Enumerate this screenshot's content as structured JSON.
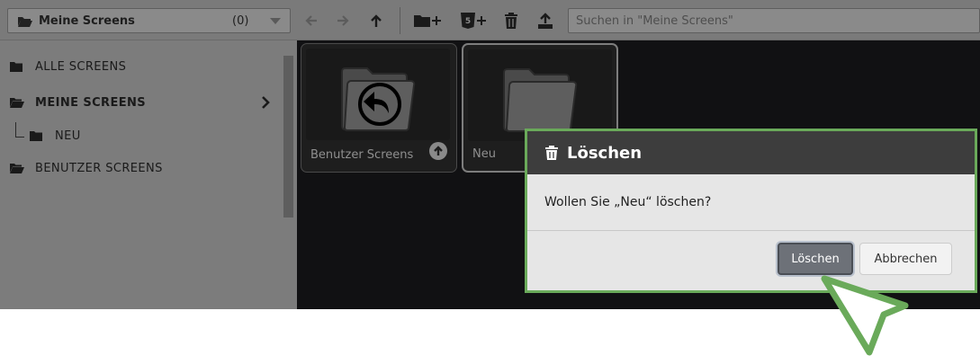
{
  "toolbar": {
    "folder_select": {
      "name": "Meine Screens",
      "count": "(0)"
    },
    "search_placeholder": "Suchen in \"Meine Screens\"",
    "buttons": [
      "back-icon",
      "forward-icon",
      "up-arrow-icon",
      "new-folder-icon",
      "new-html5-screen-icon",
      "trash-icon",
      "upload-icon"
    ]
  },
  "sidebar": {
    "items": [
      {
        "label": "ALLE SCREENS",
        "icon": "folder-icon"
      },
      {
        "label": "MEINE SCREENS",
        "icon": "folder-open-icon",
        "active": true
      },
      {
        "label": "NEU",
        "icon": "folder-icon"
      },
      {
        "label": "BENUTZER SCREENS",
        "icon": "folder-open-icon"
      }
    ]
  },
  "content": {
    "tiles": [
      {
        "label": "Benutzer Screens",
        "icon": "folder-back-icon"
      },
      {
        "label": "Neu",
        "icon": "folder-icon",
        "selected": true
      }
    ]
  },
  "dialog": {
    "title": "Löschen",
    "message": "Wollen Sie „Neu“ löschen?",
    "confirm_label": "Löschen",
    "cancel_label": "Abbrechen"
  },
  "colors": {
    "highlight": "#6aaa5a",
    "dialog_header": "#3d3d3d",
    "content_bg": "#111113"
  }
}
